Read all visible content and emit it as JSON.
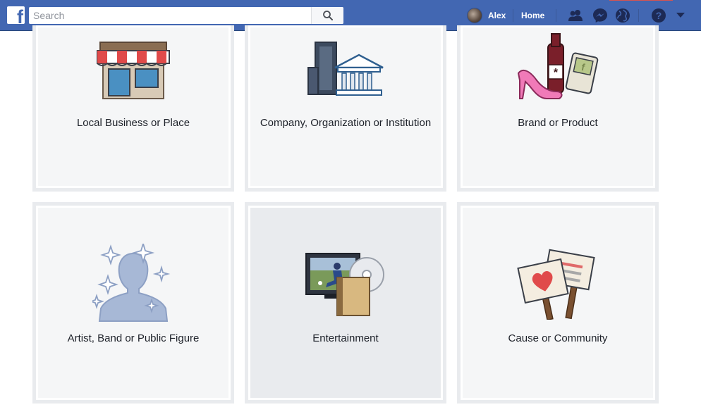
{
  "topbar": {
    "logo_letter": "f",
    "search_placeholder": "Search",
    "user_name": "Alex",
    "home_label": "Home",
    "icons": [
      "friends-icon",
      "messenger-icon",
      "globe-icon",
      "help-icon",
      "dropdown-caret-icon"
    ]
  },
  "categories": [
    {
      "label": "Local Business or Place",
      "icon": "storefront-icon"
    },
    {
      "label": "Company, Organization or Institution",
      "icon": "buildings-icon"
    },
    {
      "label": "Brand or Product",
      "icon": "products-icon"
    },
    {
      "label": "Artist, Band or Public Figure",
      "icon": "silhouette-icon"
    },
    {
      "label": "Entertainment",
      "icon": "media-icon"
    },
    {
      "label": "Cause or Community",
      "icon": "protest-signs-icon"
    }
  ],
  "colors": {
    "brand_blue": "#4267b2",
    "card_bg": "#f5f6f7",
    "card_hover_bg": "#e9ebee",
    "card_border": "#e9ebee"
  }
}
